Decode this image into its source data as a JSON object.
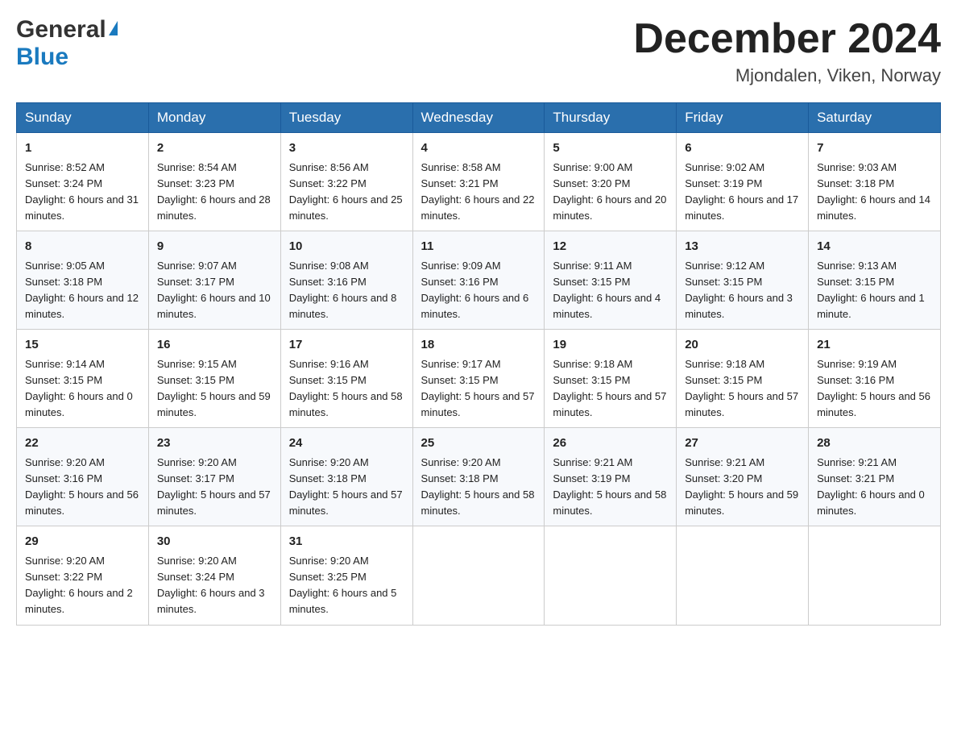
{
  "header": {
    "logo_general": "General",
    "logo_blue": "Blue",
    "month_title": "December 2024",
    "location": "Mjondalen, Viken, Norway"
  },
  "weekdays": [
    "Sunday",
    "Monday",
    "Tuesday",
    "Wednesday",
    "Thursday",
    "Friday",
    "Saturday"
  ],
  "weeks": [
    [
      {
        "day": "1",
        "sunrise": "8:52 AM",
        "sunset": "3:24 PM",
        "daylight": "6 hours and 31 minutes."
      },
      {
        "day": "2",
        "sunrise": "8:54 AM",
        "sunset": "3:23 PM",
        "daylight": "6 hours and 28 minutes."
      },
      {
        "day": "3",
        "sunrise": "8:56 AM",
        "sunset": "3:22 PM",
        "daylight": "6 hours and 25 minutes."
      },
      {
        "day": "4",
        "sunrise": "8:58 AM",
        "sunset": "3:21 PM",
        "daylight": "6 hours and 22 minutes."
      },
      {
        "day": "5",
        "sunrise": "9:00 AM",
        "sunset": "3:20 PM",
        "daylight": "6 hours and 20 minutes."
      },
      {
        "day": "6",
        "sunrise": "9:02 AM",
        "sunset": "3:19 PM",
        "daylight": "6 hours and 17 minutes."
      },
      {
        "day": "7",
        "sunrise": "9:03 AM",
        "sunset": "3:18 PM",
        "daylight": "6 hours and 14 minutes."
      }
    ],
    [
      {
        "day": "8",
        "sunrise": "9:05 AM",
        "sunset": "3:18 PM",
        "daylight": "6 hours and 12 minutes."
      },
      {
        "day": "9",
        "sunrise": "9:07 AM",
        "sunset": "3:17 PM",
        "daylight": "6 hours and 10 minutes."
      },
      {
        "day": "10",
        "sunrise": "9:08 AM",
        "sunset": "3:16 PM",
        "daylight": "6 hours and 8 minutes."
      },
      {
        "day": "11",
        "sunrise": "9:09 AM",
        "sunset": "3:16 PM",
        "daylight": "6 hours and 6 minutes."
      },
      {
        "day": "12",
        "sunrise": "9:11 AM",
        "sunset": "3:15 PM",
        "daylight": "6 hours and 4 minutes."
      },
      {
        "day": "13",
        "sunrise": "9:12 AM",
        "sunset": "3:15 PM",
        "daylight": "6 hours and 3 minutes."
      },
      {
        "day": "14",
        "sunrise": "9:13 AM",
        "sunset": "3:15 PM",
        "daylight": "6 hours and 1 minute."
      }
    ],
    [
      {
        "day": "15",
        "sunrise": "9:14 AM",
        "sunset": "3:15 PM",
        "daylight": "6 hours and 0 minutes."
      },
      {
        "day": "16",
        "sunrise": "9:15 AM",
        "sunset": "3:15 PM",
        "daylight": "5 hours and 59 minutes."
      },
      {
        "day": "17",
        "sunrise": "9:16 AM",
        "sunset": "3:15 PM",
        "daylight": "5 hours and 58 minutes."
      },
      {
        "day": "18",
        "sunrise": "9:17 AM",
        "sunset": "3:15 PM",
        "daylight": "5 hours and 57 minutes."
      },
      {
        "day": "19",
        "sunrise": "9:18 AM",
        "sunset": "3:15 PM",
        "daylight": "5 hours and 57 minutes."
      },
      {
        "day": "20",
        "sunrise": "9:18 AM",
        "sunset": "3:15 PM",
        "daylight": "5 hours and 57 minutes."
      },
      {
        "day": "21",
        "sunrise": "9:19 AM",
        "sunset": "3:16 PM",
        "daylight": "5 hours and 56 minutes."
      }
    ],
    [
      {
        "day": "22",
        "sunrise": "9:20 AM",
        "sunset": "3:16 PM",
        "daylight": "5 hours and 56 minutes."
      },
      {
        "day": "23",
        "sunrise": "9:20 AM",
        "sunset": "3:17 PM",
        "daylight": "5 hours and 57 minutes."
      },
      {
        "day": "24",
        "sunrise": "9:20 AM",
        "sunset": "3:18 PM",
        "daylight": "5 hours and 57 minutes."
      },
      {
        "day": "25",
        "sunrise": "9:20 AM",
        "sunset": "3:18 PM",
        "daylight": "5 hours and 58 minutes."
      },
      {
        "day": "26",
        "sunrise": "9:21 AM",
        "sunset": "3:19 PM",
        "daylight": "5 hours and 58 minutes."
      },
      {
        "day": "27",
        "sunrise": "9:21 AM",
        "sunset": "3:20 PM",
        "daylight": "5 hours and 59 minutes."
      },
      {
        "day": "28",
        "sunrise": "9:21 AM",
        "sunset": "3:21 PM",
        "daylight": "6 hours and 0 minutes."
      }
    ],
    [
      {
        "day": "29",
        "sunrise": "9:20 AM",
        "sunset": "3:22 PM",
        "daylight": "6 hours and 2 minutes."
      },
      {
        "day": "30",
        "sunrise": "9:20 AM",
        "sunset": "3:24 PM",
        "daylight": "6 hours and 3 minutes."
      },
      {
        "day": "31",
        "sunrise": "9:20 AM",
        "sunset": "3:25 PM",
        "daylight": "6 hours and 5 minutes."
      },
      null,
      null,
      null,
      null
    ]
  ]
}
